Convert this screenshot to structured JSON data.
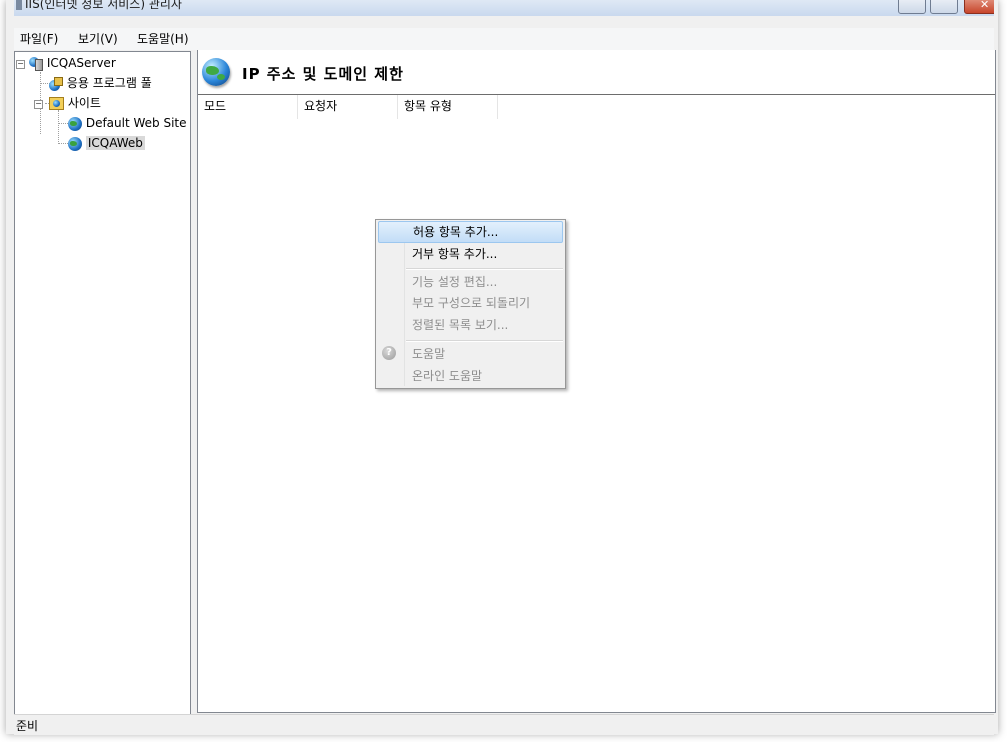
{
  "window": {
    "title": "IIS(인터넷 정보 서비스) 관리자",
    "close_glyph": "✕"
  },
  "menu": {
    "items": [
      "파일(F)",
      "보기(V)",
      "도움말(H)"
    ]
  },
  "tree": {
    "server": "ICQAServer",
    "app_pools": "응용 프로그램 풀",
    "sites": "사이트",
    "site_items": [
      "Default Web Site",
      "ICQAWeb"
    ],
    "selected": "ICQAWeb",
    "expand_glyph": "−"
  },
  "feature": {
    "title": "IP 주소 및 도메인 제한",
    "columns": [
      "모드",
      "요청자",
      "항목 유형"
    ]
  },
  "context_menu": {
    "items": [
      {
        "label": "허용 항목 추가...",
        "state": "highlighted"
      },
      {
        "label": "거부 항목 추가...",
        "state": "enabled"
      },
      {
        "label": "기능 설정 편집...",
        "state": "disabled"
      },
      {
        "label": "부모 구성으로 되돌리기",
        "state": "disabled"
      },
      {
        "label": "정렬된 목록 보기...",
        "state": "disabled"
      },
      {
        "label": "도움말",
        "state": "disabled",
        "icon": "help-icon"
      },
      {
        "label": "온라인 도움말",
        "state": "disabled"
      }
    ],
    "help_glyph": "?"
  },
  "status": {
    "text": "준비"
  }
}
